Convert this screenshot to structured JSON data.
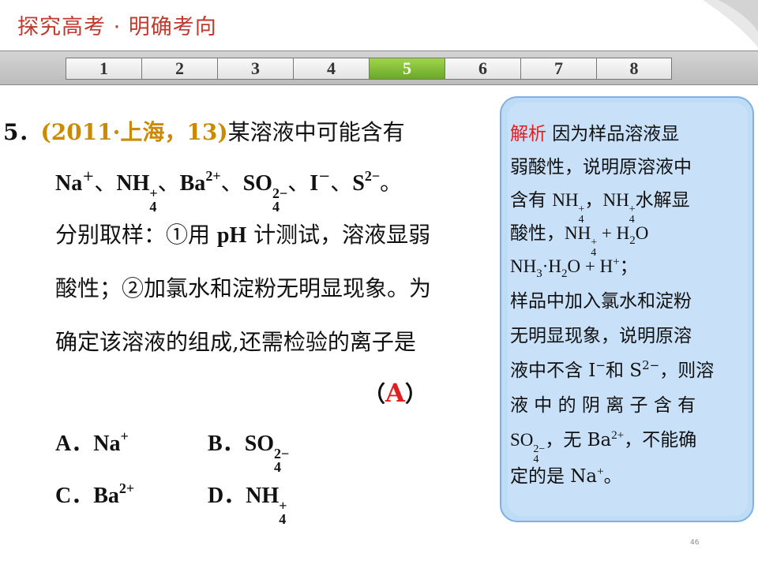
{
  "header": {
    "title": "探究高考 · 明确考向"
  },
  "nav": {
    "tabs": [
      "1",
      "2",
      "3",
      "4",
      "5",
      "6",
      "7",
      "8"
    ],
    "active_index": 4
  },
  "question": {
    "number": "5．",
    "source": "(2011·上海，13)",
    "stem_1": "某溶液中可能含有",
    "ions": {
      "na": "Na",
      "na_charge": "+",
      "sep": "、",
      "nh": "NH",
      "nh_sub": "4",
      "nh_charge": "+",
      "ba": "Ba",
      "ba_charge": "2+",
      "so": "SO",
      "so_sub": "4",
      "so_charge": "2−",
      "i": "I",
      "i_charge": "−",
      "s": "S",
      "s_charge": "2−",
      "end": "。"
    },
    "line_3_a": "分别取样：①用 ",
    "line_3_ph": "pH",
    "line_3_b": " 计测试，溶液显弱",
    "line_4": "酸性；②加氯水和淀粉无明显现象。为",
    "line_5": "确定该溶液的组成,还需检验的离子是",
    "answer_open": "（",
    "answer": "A",
    "answer_close": "）",
    "options": {
      "a_label": "A．",
      "a_ion": "Na",
      "a_charge": "+",
      "b_label": "B．",
      "b_ion": "SO",
      "b_sub": "4",
      "b_charge": "2−",
      "c_label": "C．",
      "c_ion": "Ba",
      "c_charge": "2+",
      "d_label": "D．",
      "d_ion": "NH",
      "d_sub": "4",
      "d_charge": "+"
    }
  },
  "analysis": {
    "label": "解析",
    "l1": "  因为样品溶液显",
    "l2": "弱酸性，说明原溶液中",
    "l3_a": "含有 ",
    "nh": "NH",
    "nh_sub": "4",
    "nh_charge": "+",
    "l3_b": "，",
    "l3_c": "水解显",
    "l4_a": "酸性，",
    "l4_b": " + H",
    "h2o_sub": "2",
    "l4_c": "O",
    "l5_a": "NH",
    "l5_sub": "3",
    "l5_b": "·H",
    "l5_c": "O + H",
    "h_charge": "+",
    "l5_d": "；",
    "l6": "样品中加入氯水和淀粉",
    "l7": "无明显现象，说明原溶",
    "l8_a": "液中不含 I",
    "i_charge": "−",
    "l8_b": "和 S",
    "s_charge": "2−",
    "l8_c": "，则溶",
    "l9": "液 中 的 阴 离 子 含 有",
    "l10_a": "SO",
    "so_sub": "4",
    "so_charge": "2−",
    "l10_b": "，无 Ba",
    "ba_charge": "2+",
    "l10_c": "，不能确",
    "l11_a": "定的是 Na",
    "na_charge": "+",
    "l11_b": "。"
  },
  "footer": {
    "page_number": "46"
  }
}
